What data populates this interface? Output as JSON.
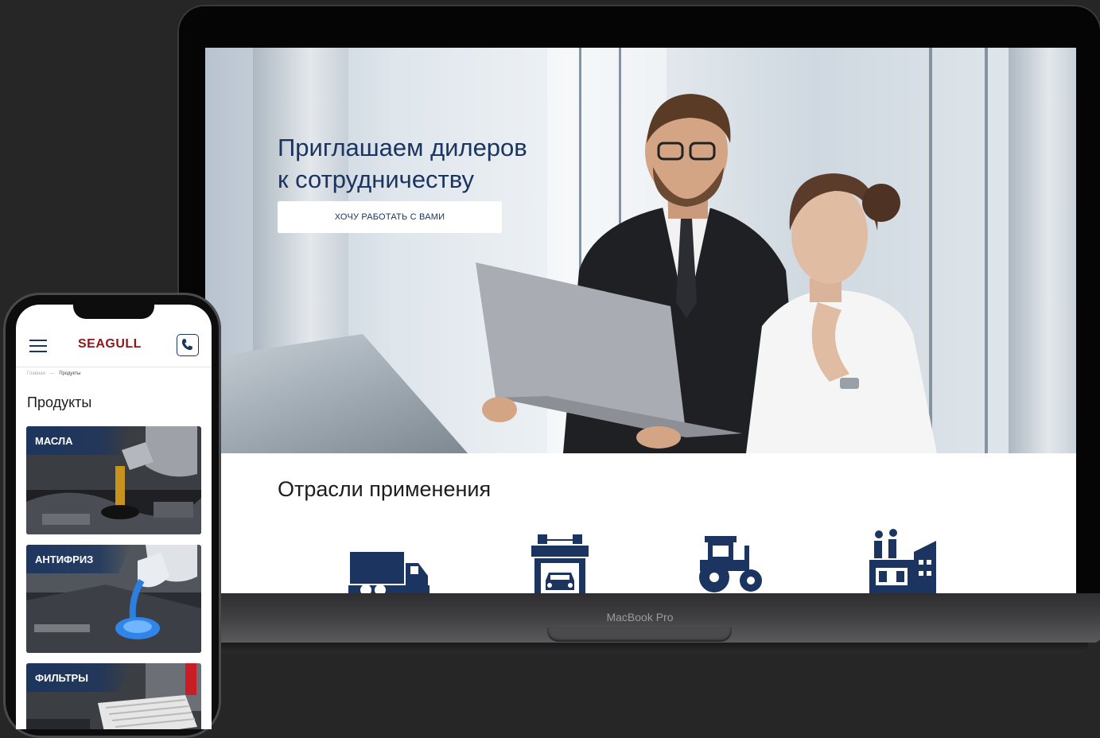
{
  "laptop": {
    "brand": "MacBook Pro",
    "hero": {
      "title_line1": "Приглашаем дилеров",
      "title_line2": "к сотрудничеству",
      "button_label": "ХОЧУ РАБОТАТЬ С ВАМИ"
    },
    "industries": {
      "title": "Отрасли применения",
      "icons": [
        "truck-icon",
        "car-service-icon",
        "tractor-icon",
        "factory-icon"
      ]
    }
  },
  "phone": {
    "logo": "SEAGULL",
    "breadcrumb": {
      "home": "Главная",
      "separator": "—",
      "current": "Продукты"
    },
    "title": "Продукты",
    "products": [
      {
        "label": "МАСЛА"
      },
      {
        "label": "АНТИФРИЗ"
      },
      {
        "label": "ФИЛЬТРЫ"
      }
    ]
  },
  "colors": {
    "background": "#262626",
    "brand_navy": "#1b3560",
    "logo_red": "#8c1a1d"
  }
}
